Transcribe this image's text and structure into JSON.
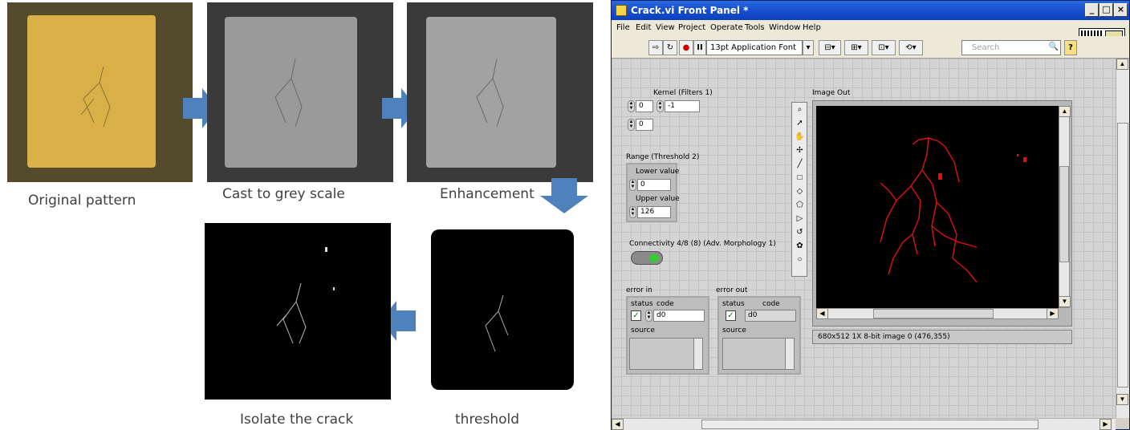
{
  "pipeline": {
    "captions": {
      "original": "Original pattern",
      "grey": "Cast to grey scale",
      "enhance": "Enhancement",
      "isolate": "Isolate the crack",
      "threshold": "threshold"
    }
  },
  "window": {
    "title": "Crack.vi Front Panel *",
    "controls": {
      "minimize": "_",
      "maximize": "□",
      "close": "×"
    }
  },
  "menu": [
    "File",
    "Edit",
    "View",
    "Project",
    "Operate",
    "Tools",
    "Window",
    "Help"
  ],
  "toolbar": {
    "font": "13pt Application Font",
    "search_placeholder": "Search",
    "help": "?"
  },
  "panel": {
    "kernel": {
      "label": "Kernel (Filters 1)",
      "index_row": "0",
      "index_col": "0",
      "value": "-1"
    },
    "range": {
      "label": "Range (Threshold 2)",
      "lower_label": "Lower value",
      "lower": "0",
      "upper_label": "Upper value",
      "upper": "126"
    },
    "connectivity": {
      "label": "Connectivity 4/8 (8) (Adv. Morphology 1)"
    },
    "error_in": {
      "label": "error in",
      "status": "status",
      "code_label": "code",
      "code": "d0",
      "source": "source"
    },
    "error_out": {
      "label": "error out",
      "status": "status",
      "code_label": "code",
      "code": "d0",
      "source": "source"
    },
    "image_out": {
      "label": "Image Out",
      "info": "680x512 1X 8-bit image 0   (476,355)"
    }
  },
  "colors": {
    "title_blue": "#1c52cf",
    "crack_red": "#e01010",
    "led_green": "#33cc33"
  }
}
